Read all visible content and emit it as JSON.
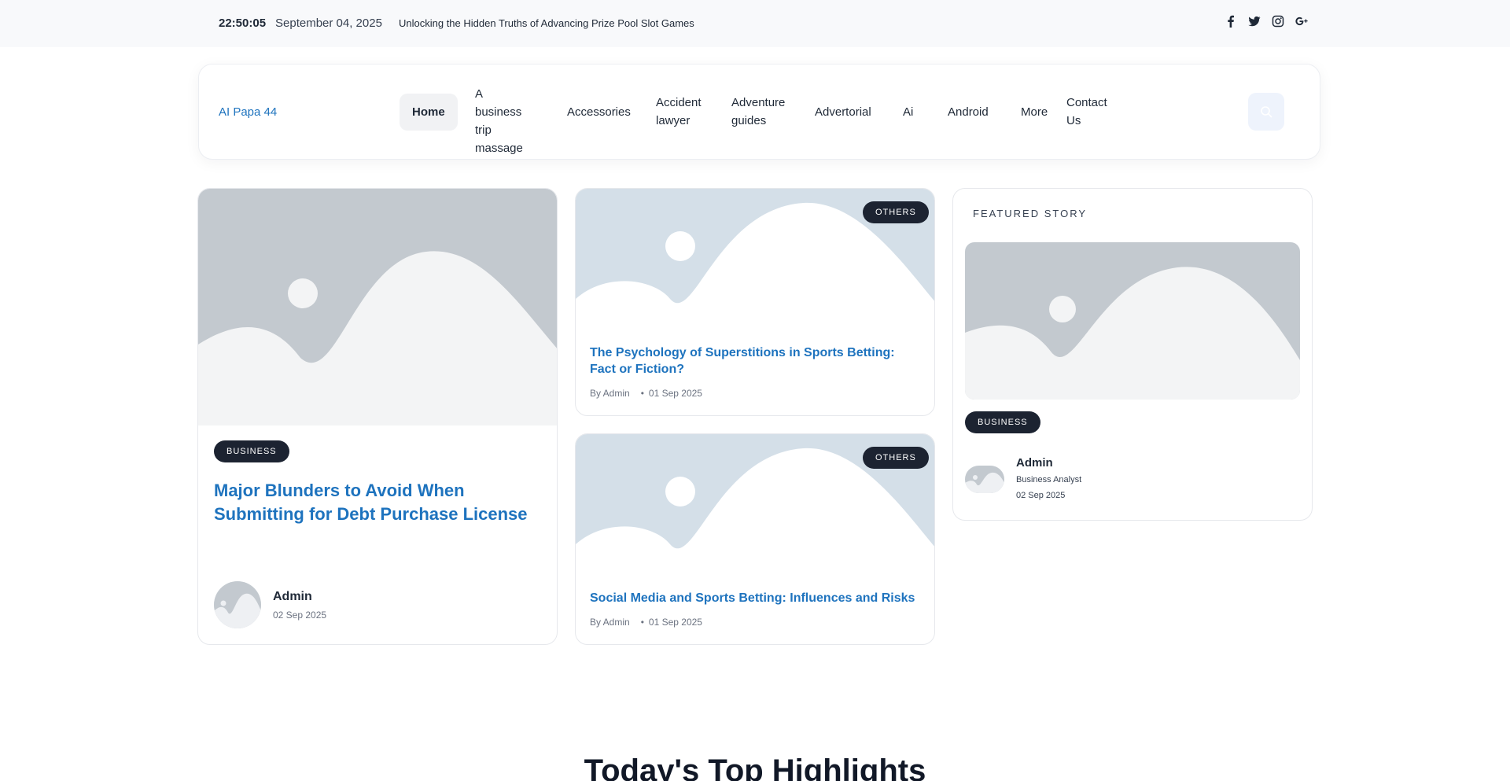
{
  "topbar": {
    "time": "22:50:05",
    "date": "September 04, 2025",
    "ticker": "Unlocking the Hidden Truths of Advancing Prize Pool Slot Games",
    "social": [
      "facebook-icon",
      "twitter-icon",
      "instagram-icon",
      "google-plus-icon"
    ]
  },
  "header": {
    "brand": "AI Papa 44",
    "nav": [
      "Home",
      "A business trip massage",
      "Accessories",
      "Accident lawyer",
      "Adventure guides",
      "Advertorial",
      "Ai",
      "Android",
      "More",
      "Contact Us"
    ],
    "active": "Home"
  },
  "main_post": {
    "category": "BUSINESS",
    "title": "Major Blunders to Avoid When Submitting for Debt Purchase License",
    "author": "Admin",
    "date": "02 Sep 2025"
  },
  "side_posts": [
    {
      "category": "OTHERS",
      "title": "The Psychology of Superstitions in Sports Betting: Fact or Fiction?",
      "author": "By Admin",
      "date": "01 Sep 2025"
    },
    {
      "category": "OTHERS",
      "title": "Social Media and Sports Betting: Influences and Risks",
      "author": "By Admin",
      "date": "01 Sep 2025"
    }
  ],
  "featured": {
    "label": "FEATURED STORY",
    "category": "BUSINESS",
    "author": "Admin",
    "role": "Business Analyst",
    "date": "02 Sep 2025"
  },
  "highlights": {
    "title": "Today's Top Highlights"
  },
  "colors": {
    "accent": "#1e73be",
    "badge_bg": "#1c2331",
    "placeholder_gray": "#c3c9cf",
    "placeholder_blue": "#d4dfe8"
  }
}
